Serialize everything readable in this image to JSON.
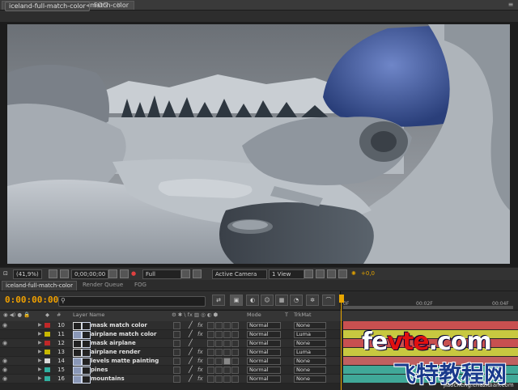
{
  "composition_panel": {
    "tab_label": "Composition: iceland-full-match-color",
    "close_glyph": "×",
    "breadcrumb_active": "iceland-full-match-color",
    "breadcrumb_sep": "◂",
    "breadcrumb_next": "FOG"
  },
  "viewer_toolbar": {
    "zoom": "(41,9%)",
    "timecode": "0;00;00;00",
    "resolution": "Full",
    "camera": "Active Camera",
    "view_layout": "1 View",
    "exposure": "+0,0"
  },
  "timeline": {
    "tabs": [
      "iceland-full-match-color",
      "Render Queue",
      "FOG"
    ],
    "timecode": "0:00:00:00",
    "search_placeholder": "",
    "ruler_labels": [
      "0F",
      "00:02F",
      "00:04F"
    ],
    "columns": {
      "layer_name": "Layer Name",
      "mode": "Mode",
      "t": "T",
      "trkmat": "TrkMat",
      "hash": "#"
    },
    "layers": [
      {
        "num": "10",
        "name": "mask match color",
        "color": "#c02828",
        "mode": "Normal",
        "trkmat": "None",
        "icon": "mask-icon",
        "bar": "#c85050"
      },
      {
        "num": "11",
        "name": "airplane match color",
        "color": "#c8b800",
        "mode": "Normal",
        "trkmat": "Luma",
        "icon": "footage-icon",
        "bar": "#c8c840"
      },
      {
        "num": "12",
        "name": "mask airplane",
        "color": "#c02828",
        "mode": "Normal",
        "trkmat": "None",
        "icon": "mask-icon",
        "bar": "#c85050"
      },
      {
        "num": "13",
        "name": "airplane render",
        "color": "#c8b800",
        "mode": "Normal",
        "trkmat": "Luma",
        "icon": "mask-icon",
        "bar": "#c8c840"
      },
      {
        "num": "14",
        "name": "levels matte painting",
        "color": "#d8d8d8",
        "mode": "Normal",
        "trkmat": "None",
        "icon": "solid-icon",
        "bar": "#c06060"
      },
      {
        "num": "15",
        "name": "pines",
        "color": "#30b0a0",
        "mode": "Normal",
        "trkmat": "None",
        "icon": "footage-icon",
        "bar": "#40a898"
      },
      {
        "num": "16",
        "name": "mountains",
        "color": "#30b0a0",
        "mode": "Normal",
        "trkmat": "None",
        "icon": "footage-icon",
        "bar": "#40a898"
      }
    ]
  },
  "watermark": {
    "line1_a": "fe",
    "line1_b": "vte",
    "line1_c": ".com",
    "line2": "飞特教程网",
    "line3": "jiaocheng.chazidian.com"
  }
}
